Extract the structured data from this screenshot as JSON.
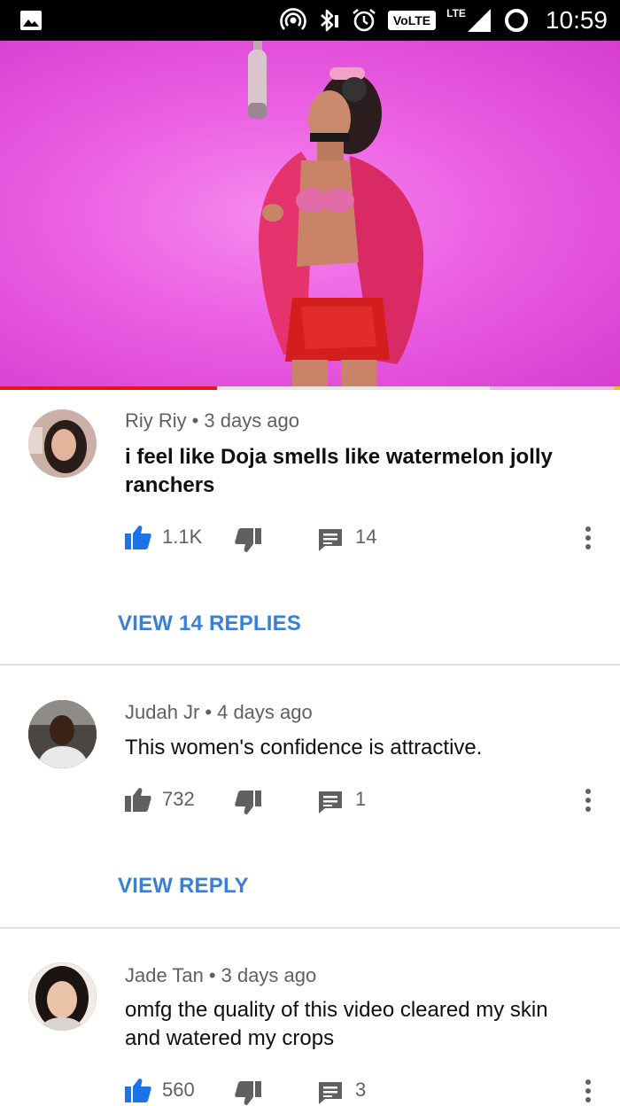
{
  "status_bar": {
    "time": "10:59",
    "volte_label": "VoLTE",
    "lte_label": "LTE",
    "icons": [
      "gallery-icon",
      "hotspot-icon",
      "bluetooth-icon",
      "alarm-icon",
      "volte-icon",
      "signal-icon",
      "battery-icon"
    ]
  },
  "video": {
    "progress": 0.35,
    "buffered": 0.79,
    "colors": {
      "background": "#ec5fe3",
      "progress": "#e6141b"
    }
  },
  "comments": [
    {
      "author": "Riy Riy",
      "separator": "•",
      "time": "3 days ago",
      "text": "i feel like Doja smells like watermelon jolly ranchers",
      "likes": "1.1K",
      "liked": true,
      "replies": "14",
      "view_replies_label": "VIEW 14 REPLIES"
    },
    {
      "author": "Judah Jr",
      "separator": "•",
      "time": "4 days ago",
      "text": "This women's confidence is attractive.",
      "likes": "732",
      "liked": false,
      "replies": "1",
      "view_replies_label": "VIEW REPLY"
    },
    {
      "author": "Jade Tan",
      "separator": "•",
      "time": "3 days ago",
      "text": "omfg the quality of this video cleared my skin and watered my crops",
      "likes": "560",
      "liked": true,
      "replies": "3"
    }
  ],
  "colors": {
    "accent_blue": "#3a7fd6",
    "like_blue": "#1a73e8",
    "icon_gray": "#606060"
  }
}
